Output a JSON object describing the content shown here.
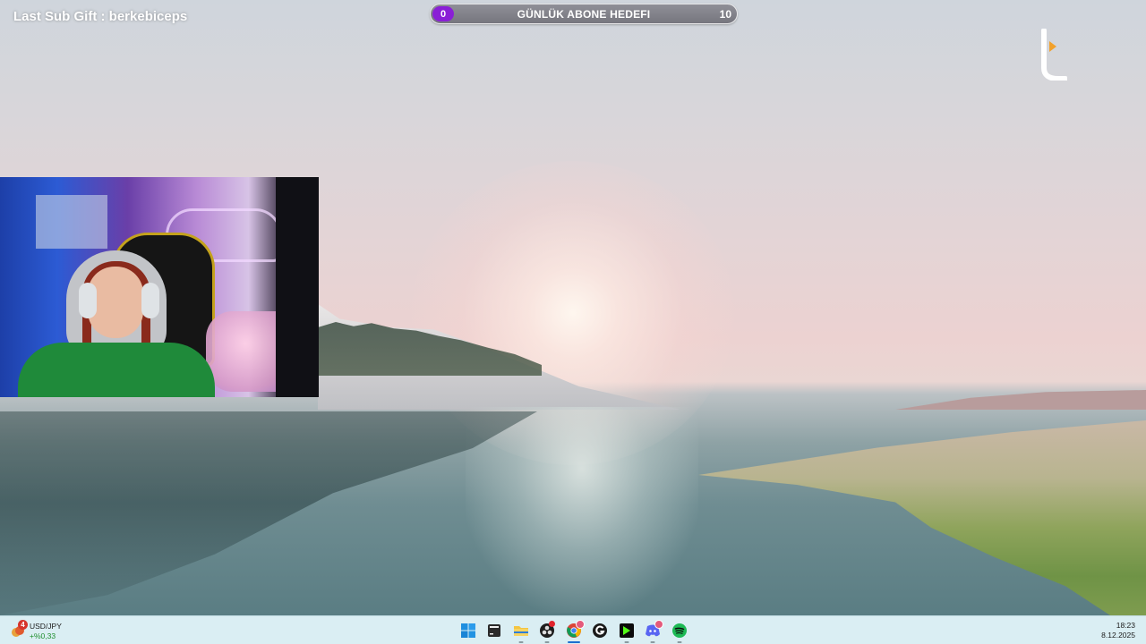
{
  "overlay": {
    "last_sub_gift": "Last Sub Gift : berkebiceps",
    "goal": {
      "title": "GÜNLÜK ABONE HEDEFI",
      "current": "0",
      "target": "10",
      "progress_fraction": 0
    },
    "logo_icon": "channel-logo-icon"
  },
  "webcam": {
    "description_icon": "streamer-webcam"
  },
  "taskbar": {
    "widget": {
      "badge": "4",
      "title": "USD/JPY",
      "change": "+%0,33",
      "icon": "stock-widget-icon"
    },
    "apps": [
      {
        "name": "start-button",
        "icon": "windows-icon",
        "active": false
      },
      {
        "name": "taskbar-app-terminal",
        "icon": "terminal-icon",
        "active": false
      },
      {
        "name": "taskbar-app-file-explorer",
        "icon": "folder-icon",
        "active": false
      },
      {
        "name": "taskbar-app-obs",
        "icon": "obs-icon",
        "active": false
      },
      {
        "name": "taskbar-app-chrome",
        "icon": "chrome-icon",
        "active": true
      },
      {
        "name": "taskbar-app-g",
        "icon": "g-icon",
        "active": false
      },
      {
        "name": "taskbar-app-kick",
        "icon": "kick-icon",
        "active": false
      },
      {
        "name": "taskbar-app-discord",
        "icon": "discord-icon",
        "active": false
      },
      {
        "name": "taskbar-app-spotify",
        "icon": "spotify-icon",
        "active": false
      }
    ],
    "clock": {
      "time": "18:23",
      "date": "8.12.2025"
    }
  },
  "colors": {
    "goal_accent": "#8a1fd6",
    "taskbar_bg": "#daeef3",
    "active_indicator": "#1c6fd0"
  }
}
